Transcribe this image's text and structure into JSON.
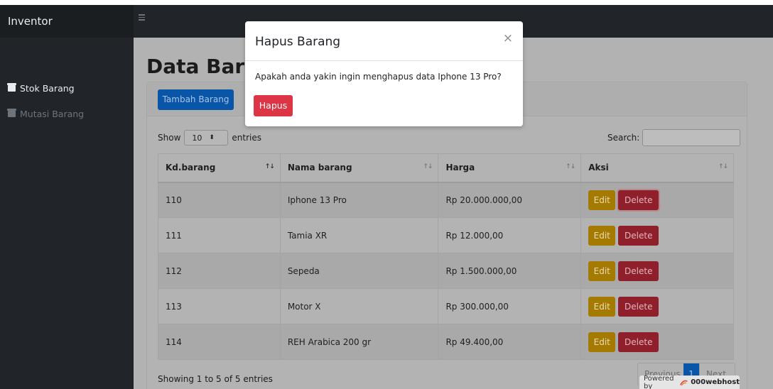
{
  "brand": "Inventor",
  "sidebar": {
    "items": [
      {
        "label": "Stok Barang",
        "icon": "box-icon"
      },
      {
        "label": "Mutasi Barang",
        "icon": "box-icon"
      }
    ]
  },
  "page": {
    "title": "Data Barang",
    "add_button": "Tambah Barang"
  },
  "datatable": {
    "show_label": "Show",
    "length_value": "10",
    "entries_label": "entries",
    "search_label": "Search:",
    "columns": [
      "Kd.barang",
      "Nama barang",
      "Harga",
      "Aksi"
    ],
    "rows": [
      {
        "kd": "110",
        "nama": "Iphone 13 Pro",
        "harga": "Rp 20.000.000,00",
        "edit": "Edit",
        "delete": "Delete"
      },
      {
        "kd": "111",
        "nama": "Tamia XR",
        "harga": "Rp 12.000,00",
        "edit": "Edit",
        "delete": "Delete"
      },
      {
        "kd": "112",
        "nama": "Sepeda",
        "harga": "Rp 1.500.000,00",
        "edit": "Edit",
        "delete": "Delete"
      },
      {
        "kd": "113",
        "nama": "Motor X",
        "harga": "Rp 300.000,00",
        "edit": "Edit",
        "delete": "Delete"
      },
      {
        "kd": "114",
        "nama": "REH Arabica 200 gr",
        "harga": "Rp 49.400,00",
        "edit": "Edit",
        "delete": "Delete"
      }
    ],
    "info": "Showing 1 to 5 of 5 entries",
    "pagination": {
      "previous": "Previous",
      "current": "1",
      "next": "Next"
    }
  },
  "modal": {
    "title": "Hapus Barang",
    "close": "×",
    "message": "Apakah anda yakin ingin menghapus data Iphone 13 Pro?",
    "confirm": "Hapus"
  },
  "footer_badge": {
    "powered_by": "Powered by",
    "brand": "000webhost"
  },
  "colors": {
    "primary": "#007bff",
    "danger": "#dc3545",
    "warning": "#ffc107",
    "sidebar": "#212529"
  }
}
